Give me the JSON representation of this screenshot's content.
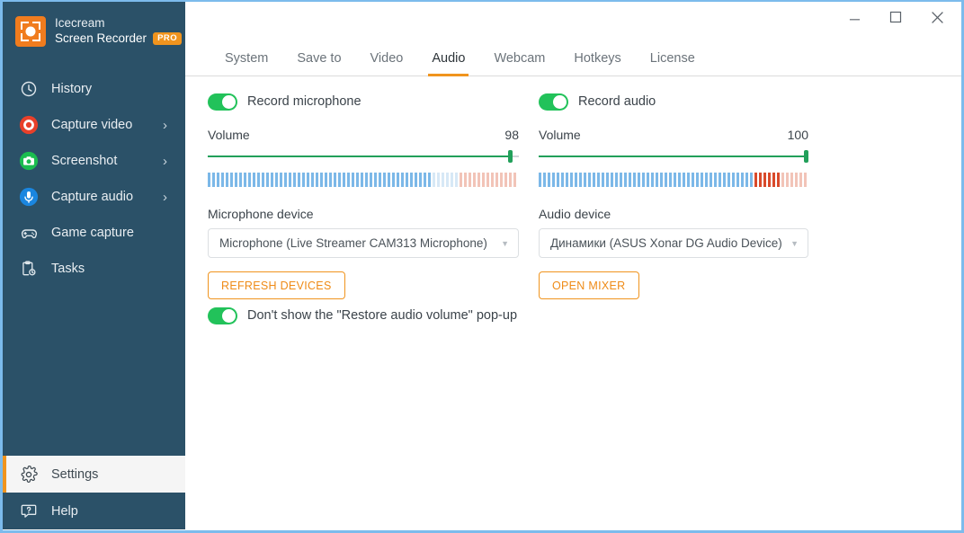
{
  "app": {
    "brand_line1": "Icecream",
    "brand_line2": "Screen Recorder",
    "pro_badge": "PRO",
    "logo_icon": "record-frame-icon"
  },
  "window_controls": {
    "minimize": "—",
    "maximize": "▢",
    "close": "✕"
  },
  "sidebar": {
    "items": [
      {
        "label": "History",
        "icon": "clock-icon",
        "chevron": "",
        "active": false
      },
      {
        "label": "Capture video",
        "icon": "record-icon",
        "chevron": "›",
        "active": false
      },
      {
        "label": "Screenshot",
        "icon": "camera-icon",
        "chevron": "›",
        "active": false
      },
      {
        "label": "Capture audio",
        "icon": "microphone-icon",
        "chevron": "›",
        "active": false
      },
      {
        "label": "Game capture",
        "icon": "gamepad-icon",
        "chevron": "",
        "active": false
      },
      {
        "label": "Tasks",
        "icon": "clipboard-clock-icon",
        "chevron": "",
        "active": false
      }
    ],
    "bottom_items": [
      {
        "label": "Settings",
        "icon": "gear-icon",
        "active": true
      },
      {
        "label": "Help",
        "icon": "help-bubble-icon",
        "active": false
      }
    ]
  },
  "tabs": [
    {
      "label": "System",
      "active": false
    },
    {
      "label": "Save to",
      "active": false
    },
    {
      "label": "Video",
      "active": false
    },
    {
      "label": "Audio",
      "active": true
    },
    {
      "label": "Webcam",
      "active": false
    },
    {
      "label": "Hotkeys",
      "active": false
    },
    {
      "label": "License",
      "active": false
    }
  ],
  "microphone": {
    "toggle_label": "Record microphone",
    "toggle_on": true,
    "volume_label": "Volume",
    "volume_value": "98",
    "volume_percent": 98,
    "device_label": "Microphone device",
    "device_value": "Microphone (Live Streamer CAM313 Microphone)",
    "button_label": "REFRESH DEVICES",
    "meter": {
      "total_bars": 69,
      "blue_bars": 50,
      "light_blue_bars": 6,
      "red_bars": 0,
      "light_red_bars": 13
    }
  },
  "audio": {
    "toggle_label": "Record audio",
    "toggle_on": true,
    "volume_label": "Volume",
    "volume_value": "100",
    "volume_percent": 100,
    "device_label": "Audio device",
    "device_value": "Динамики (ASUS Xonar DG Audio Device)",
    "button_label": "OPEN MIXER",
    "meter": {
      "total_bars": 60,
      "blue_bars": 48,
      "light_blue_bars": 0,
      "red_bars": 6,
      "light_red_bars": 6
    }
  },
  "restore_popup": {
    "toggle_label": "Don't show the \"Restore audio volume\" pop-up",
    "toggle_on": true
  },
  "colors": {
    "sidebar_bg": "#2b5168",
    "accent_orange": "#f0941e",
    "toggle_green": "#22c25a",
    "slider_green": "#22a05a",
    "meter_blue": "#7cb8e8",
    "meter_light_blue": "#d7e8f6",
    "meter_red": "#d94a2b",
    "meter_light_red": "#f2c4b8",
    "window_border": "#7cbbec"
  }
}
